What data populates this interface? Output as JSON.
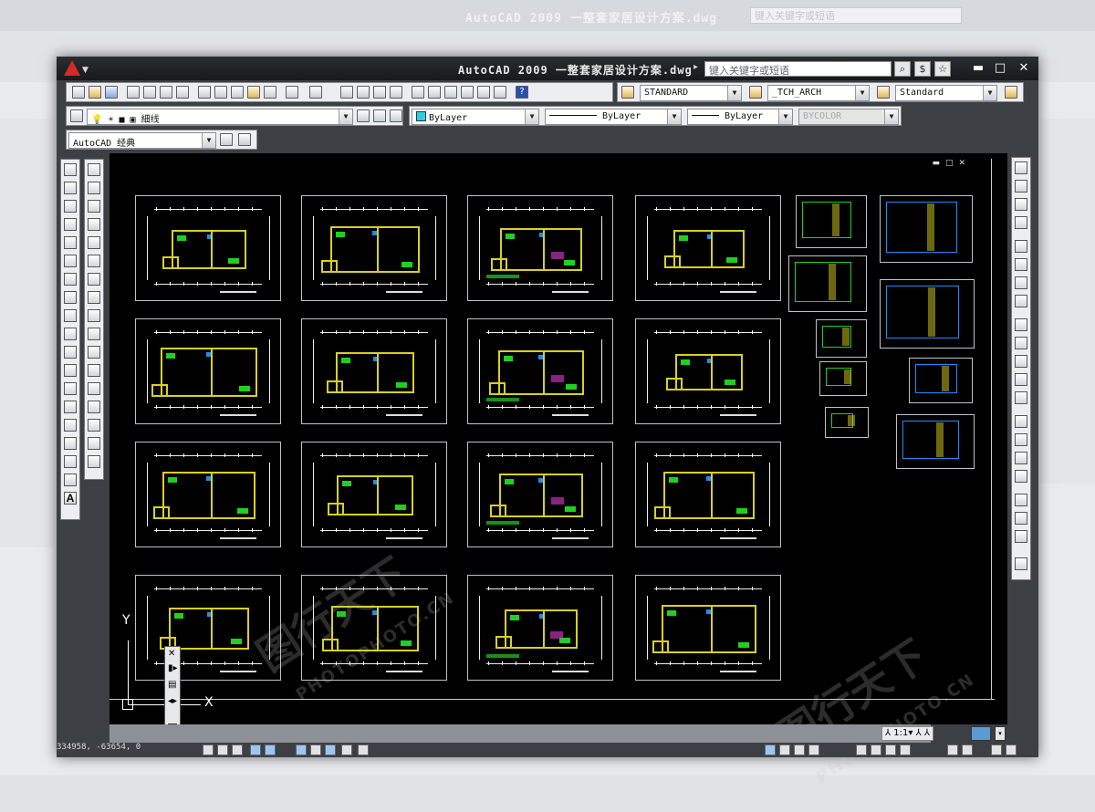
{
  "window": {
    "title": "AutoCAD 2009  一整套家居设计方案.dwg",
    "search_placeholder": "键入关键字或短语",
    "minimize": "▬",
    "maximize": "□",
    "close": "✕"
  },
  "toolbar_styles": {
    "text_style": "STANDARD",
    "dim_style": "_TCH_ARCH",
    "table_style": "Standard"
  },
  "toolbar_layers": {
    "layer_name": "細线",
    "color": "ByLayer",
    "linetype": "ByLayer",
    "lineweight": "ByLayer",
    "plotstyle": "BYCOLOR"
  },
  "workspace": {
    "name": "AutoCAD 经典"
  },
  "ucs": {
    "x_label": "X",
    "y_label": "Y"
  },
  "status": {
    "coords": "334958, -63654, 0",
    "annotation_scale": "1:1"
  },
  "watermark": {
    "brand": "图行天下",
    "url": "PHOTOPHOTO.CN"
  },
  "colors": {
    "canvas": "#000000",
    "wall": "#d9d020",
    "furniture": "#1fd11f",
    "fixtures": "#1c8cff",
    "accent": "#e53ad5",
    "logo": "#d32a2a"
  }
}
